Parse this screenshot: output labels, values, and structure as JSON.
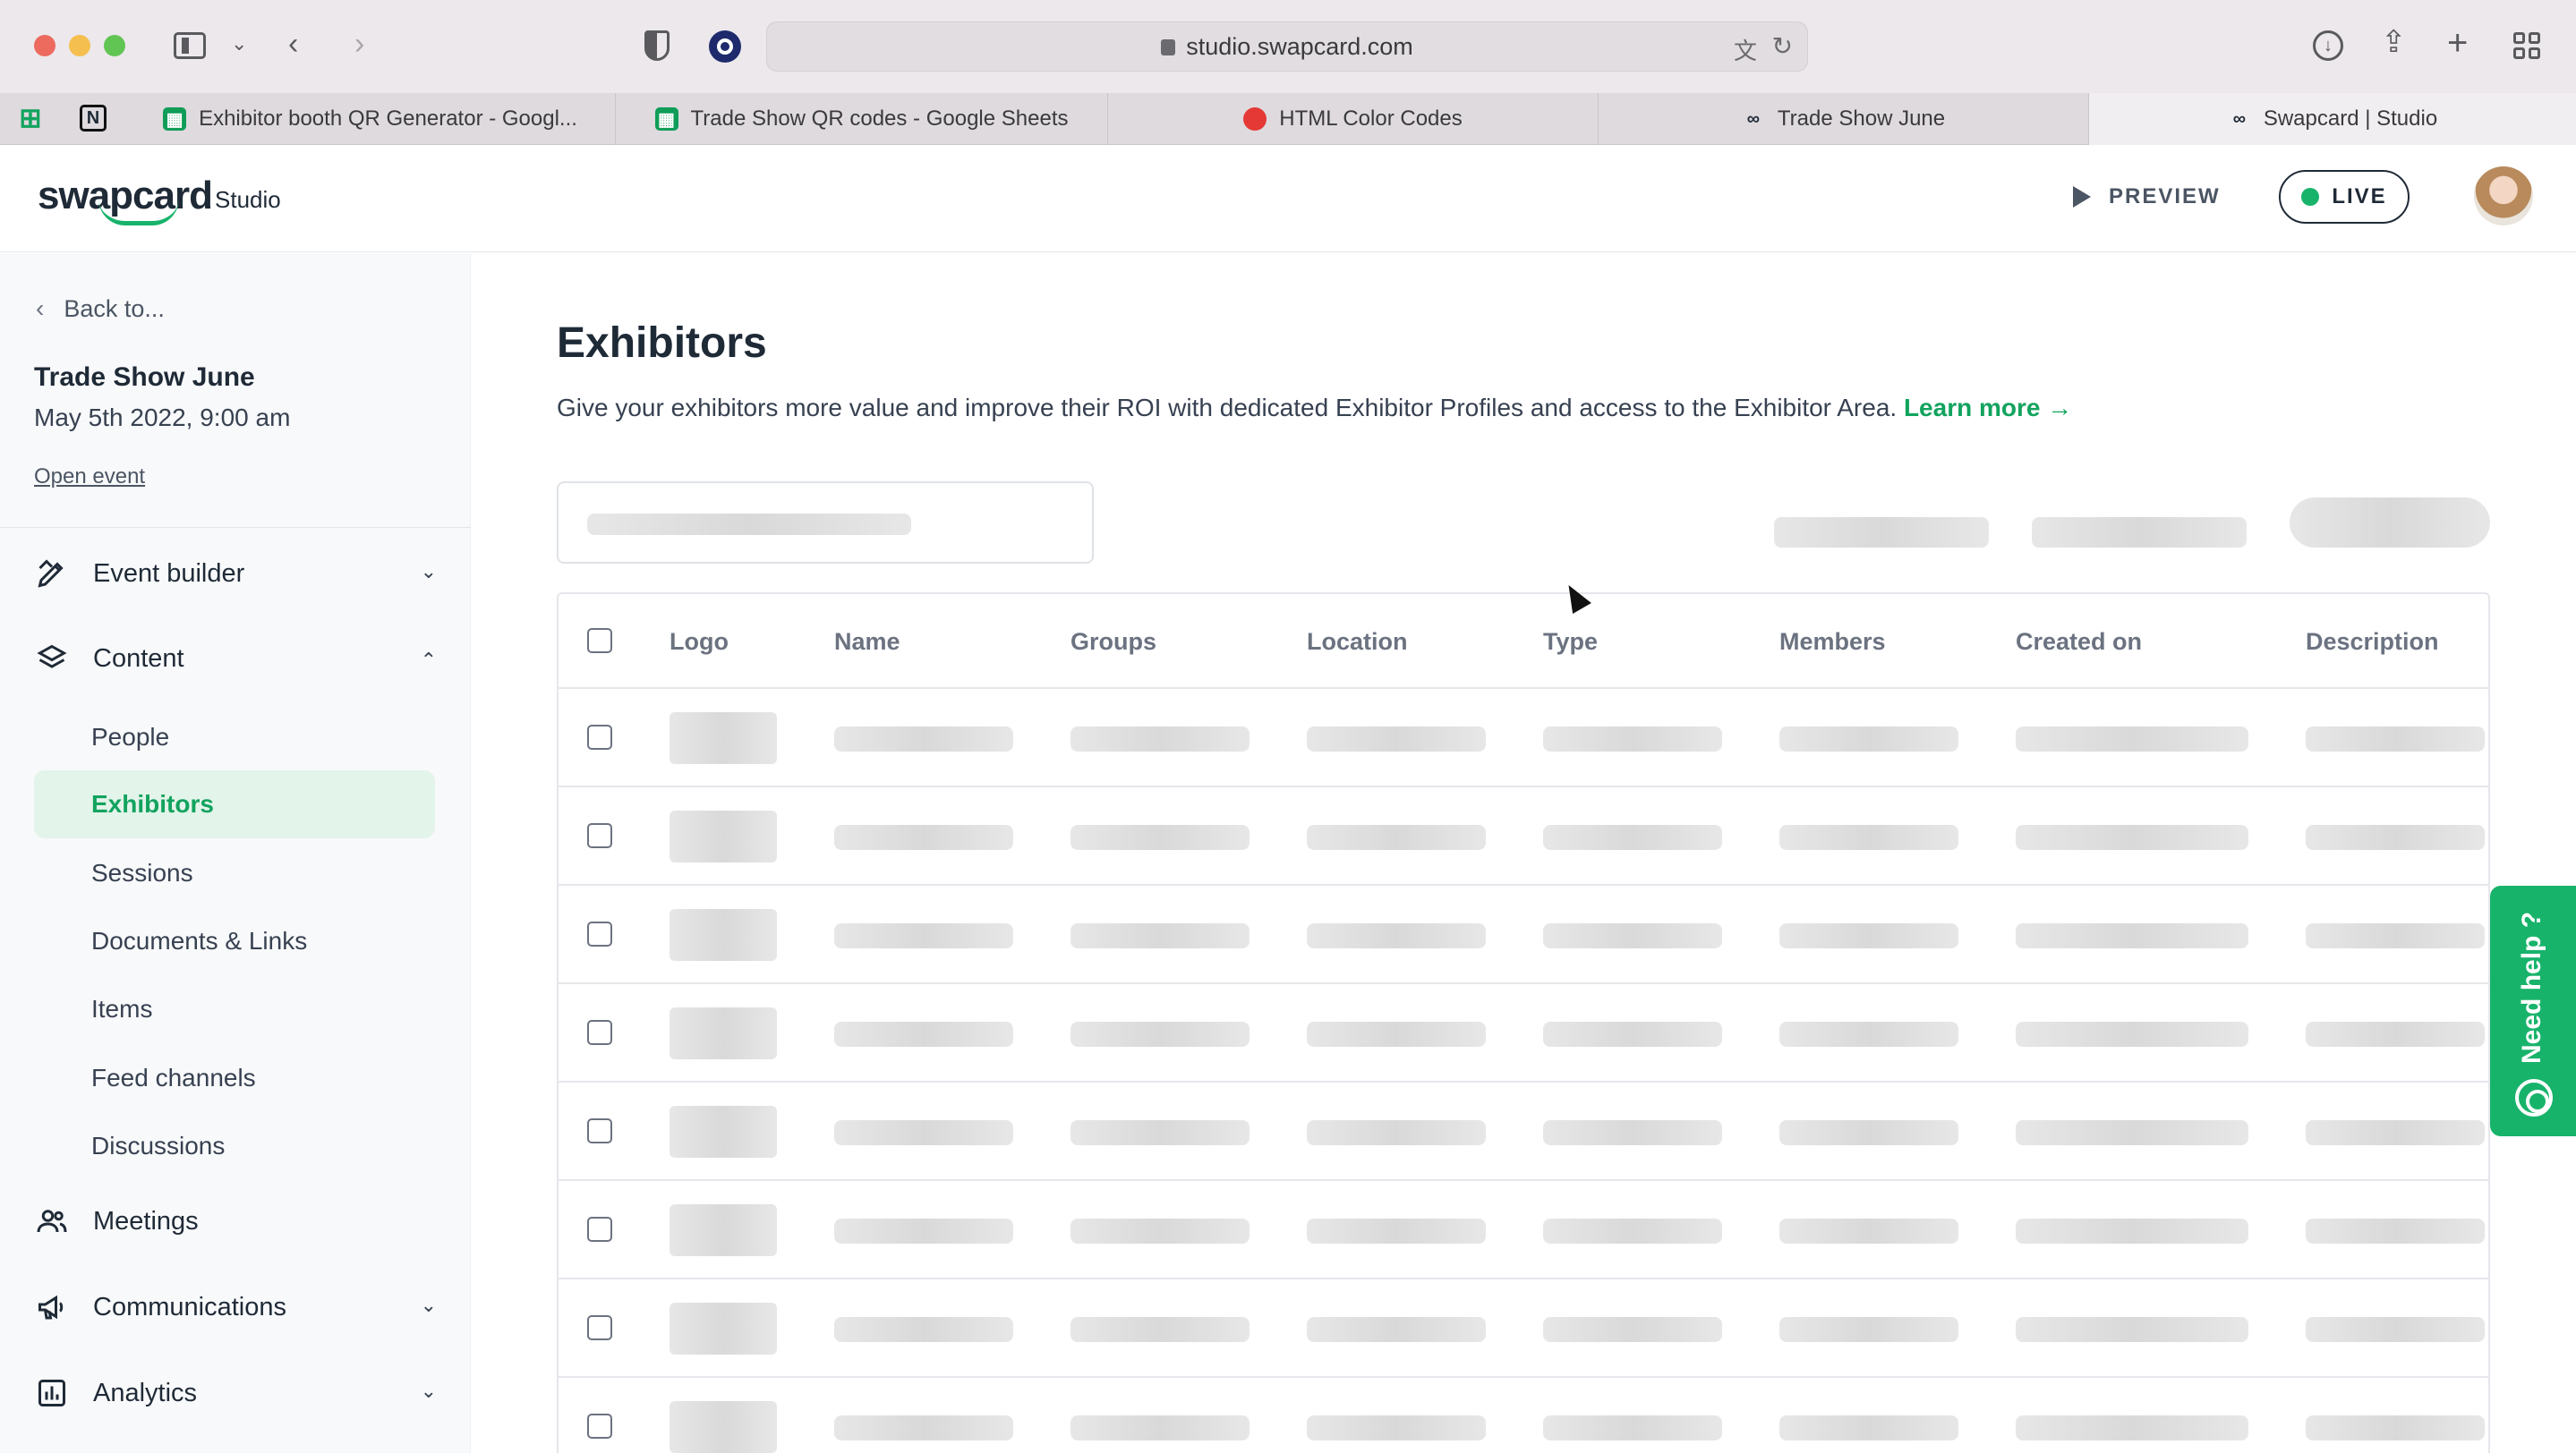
{
  "browser": {
    "url": "studio.swapcard.com",
    "tabs": [
      {
        "label": "Exhibitor booth QR Generator - Googl...",
        "icon": "google-sheets-icon"
      },
      {
        "label": "Trade Show QR codes - Google Sheets",
        "icon": "google-sheets-icon"
      },
      {
        "label": "HTML Color Codes",
        "icon": "html-color-codes-icon"
      },
      {
        "label": "Trade Show June",
        "icon": "swapcard-icon"
      },
      {
        "label": "Swapcard | Studio",
        "icon": "swapcard-icon"
      }
    ]
  },
  "header": {
    "logo_text": "swapcard",
    "logo_sub": "Studio",
    "preview_label": "PREVIEW",
    "live_label": "LIVE"
  },
  "sidebar": {
    "back_label": "Back to...",
    "event_title": "Trade Show June",
    "event_date": "May 5th 2022, 9:00 am",
    "open_event": "Open event",
    "sections": [
      {
        "label": "Event builder",
        "icon": "pencil-ruler-icon"
      },
      {
        "label": "Content",
        "icon": "layers-icon"
      },
      {
        "label": "Meetings",
        "icon": "people-icon"
      },
      {
        "label": "Communications",
        "icon": "megaphone-icon"
      },
      {
        "label": "Analytics",
        "icon": "bar-chart-icon"
      }
    ],
    "content_items": [
      "People",
      "Exhibitors",
      "Sessions",
      "Documents & Links",
      "Items",
      "Feed channels",
      "Discussions"
    ]
  },
  "main": {
    "title": "Exhibitors",
    "description": "Give your exhibitors more value and improve their ROI with dedicated Exhibitor Profiles and access to the Exhibitor Area.",
    "learn_more": "Learn more",
    "columns": [
      "Logo",
      "Name",
      "Groups",
      "Location",
      "Type",
      "Members",
      "Created on",
      "Description"
    ]
  },
  "help_label": "Need help ?",
  "colors": {
    "accent": "#18b36b",
    "active_bg": "#e3f4ea"
  }
}
